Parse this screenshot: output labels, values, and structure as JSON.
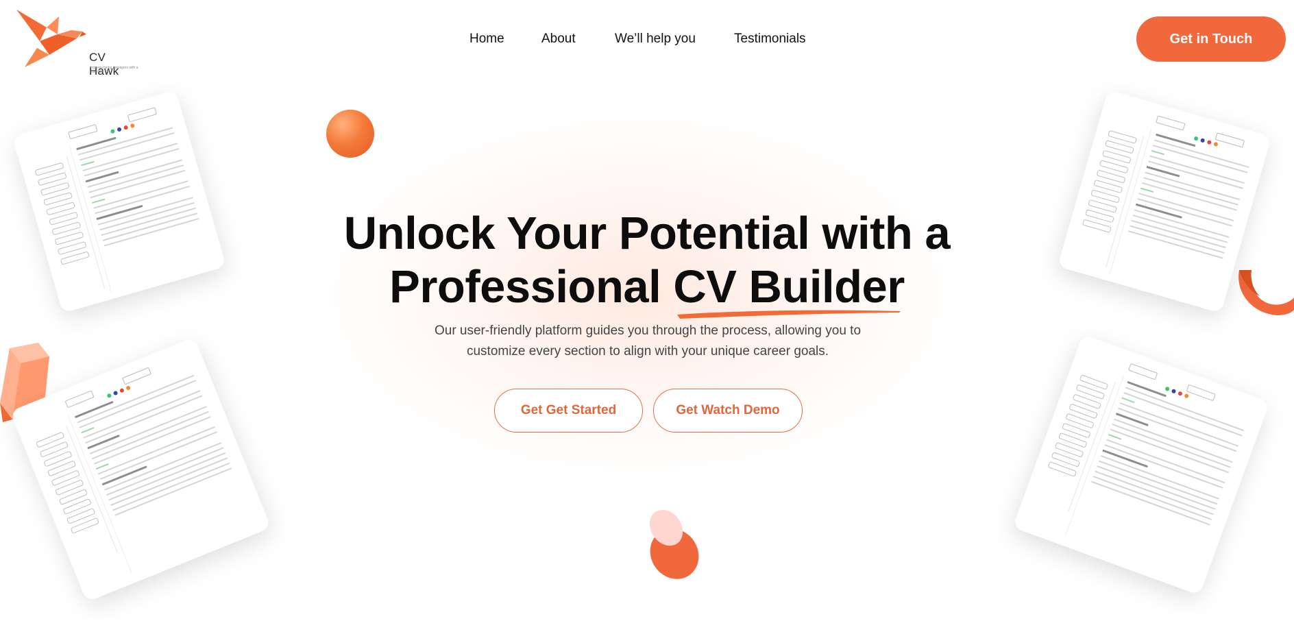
{
  "brand": {
    "name": "CV Hawk",
    "tagline": "Impress hiring managers with a standout CV",
    "accent_color": "#f0683c",
    "logo_icon": "origami-bird-icon"
  },
  "nav": {
    "items": [
      "Home",
      "About",
      "We’ll help you",
      "Testimonials"
    ],
    "cta_label": "Get in Touch"
  },
  "hero": {
    "title_line1": "Unlock Your Potential with a",
    "title_line2": "Professional CV Builder",
    "subtitle_line1": "Our user-friendly platform guides you through the process, allowing you to",
    "subtitle_line2": "customize every section to align with your unique career goals.",
    "primary_button": "Get Get Started",
    "secondary_button": "Get Watch Demo"
  },
  "decor": {
    "shapes": [
      "orange-sphere",
      "orange-ring",
      "peach-prism",
      "orange-capsule"
    ],
    "cv_cards": 4
  }
}
